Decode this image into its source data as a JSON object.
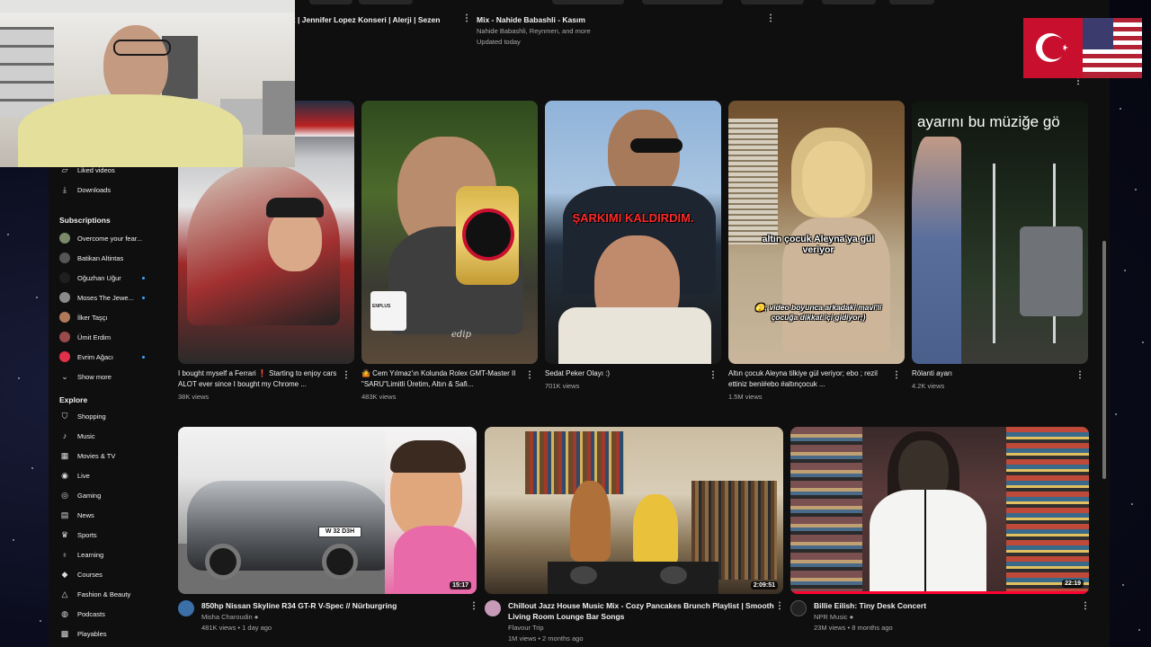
{
  "top_row": {
    "item1_title": "m 2 | Jennifer Lopez Konseri | Alerji | Sezen",
    "item2_title": "Mix - Nahide Babashli - Kasım",
    "item2_channels": "Nahide Babashli, Reynmen, and more",
    "item2_updated": "Updated today"
  },
  "sidebar": {
    "you_items": [
      {
        "label": "Liked videos",
        "icon": "thumbs-up-icon"
      },
      {
        "label": "Downloads",
        "icon": "download-icon"
      }
    ],
    "subscriptions_heading": "Subscriptions",
    "subscriptions": [
      {
        "label": "Overcome your fear...",
        "color": "#7a8a6a",
        "live": false
      },
      {
        "label": "Batikan Altintas",
        "color": "#555555",
        "live": false
      },
      {
        "label": "Oğuzhan Uğur",
        "color": "#1f1f1f",
        "live": true
      },
      {
        "label": "Moses The Jewe...",
        "color": "#8a8a8a",
        "live": true
      },
      {
        "label": "İlker Taşçı",
        "color": "#b07a5a",
        "live": false
      },
      {
        "label": "Ümit Erdim",
        "color": "#9a4a4a",
        "live": false
      },
      {
        "label": "Evrim Ağacı",
        "color": "#e0304a",
        "live": true
      }
    ],
    "show_more": "Show more",
    "explore_heading": "Explore",
    "explore": [
      {
        "label": "Shopping",
        "icon": "shopping-bag-icon",
        "glyph": "⛉"
      },
      {
        "label": "Music",
        "icon": "music-note-icon",
        "glyph": "♪"
      },
      {
        "label": "Movies & TV",
        "icon": "clapperboard-icon",
        "glyph": "▦"
      },
      {
        "label": "Live",
        "icon": "live-broadcast-icon",
        "glyph": "◉"
      },
      {
        "label": "Gaming",
        "icon": "gamepad-icon",
        "glyph": "◎"
      },
      {
        "label": "News",
        "icon": "newspaper-icon",
        "glyph": "▤"
      },
      {
        "label": "Sports",
        "icon": "trophy-icon",
        "glyph": "♛"
      },
      {
        "label": "Learning",
        "icon": "lightbulb-icon",
        "glyph": "♁"
      },
      {
        "label": "Courses",
        "icon": "graduation-cap-icon",
        "glyph": "◆"
      },
      {
        "label": "Fashion & Beauty",
        "icon": "hanger-icon",
        "glyph": "△"
      },
      {
        "label": "Podcasts",
        "icon": "podcast-icon",
        "glyph": "◍"
      },
      {
        "label": "Playables",
        "icon": "playables-grid-icon",
        "glyph": "▩"
      }
    ]
  },
  "shorts": [
    {
      "title": "I bought myself a Ferrari ❗️ Starting to enjoy cars ALOT ever since I bought my Chrome ...",
      "views": "38K views"
    },
    {
      "title": "🤷 Cem Yılmaz'ın Kolunda Rolex GMT-Master II \"SARU\"Limitli Üretim, Altın & Safi...",
      "views": "483K views",
      "mug_text": "ENPLUS",
      "logo_text": "edip"
    },
    {
      "title": "Sedat Peker Olayı :)",
      "views": "701K views",
      "overlay": "ŞARKIMI KALDIRDIM."
    },
    {
      "title": "Altın çocuk Aleyna tilkiye gül veriyor; ebo ; rezil ettiniz beni#ebo #altınçocuk ...",
      "views": "1.5M views",
      "overlay1": "altın çocuk Aleyna'ya gül veriyor",
      "overlay2": "🫣; video boyunca arkadaki mavi'li çocuğa dikkat içi gidiyor;)"
    },
    {
      "title": "Rölanti ayarı",
      "views": "4.2K views",
      "overlay": "ayarını bu müziğe gö"
    }
  ],
  "videos": [
    {
      "title": "850hp Nissan Skyline R34 GT-R V-Spec // Nürburgring",
      "channel": "Misha Charoudin",
      "meta": "481K views • 1 day ago",
      "duration": "15:17",
      "plate": "W 32 D3H",
      "verified": true
    },
    {
      "title": "Chillout Jazz House Music Mix - Cozy Pancakes Brunch Playlist | Smooth Living Room Lounge Bar Songs",
      "channel": "Flavour Trip",
      "meta": "1M views • 2 months ago",
      "duration": "2:09:51",
      "verified": false
    },
    {
      "title": "Billie Eilish: Tiny Desk Concert",
      "channel": "NPR Music",
      "meta": "23M views • 8 months ago",
      "duration": "22:19",
      "verified": true
    }
  ]
}
